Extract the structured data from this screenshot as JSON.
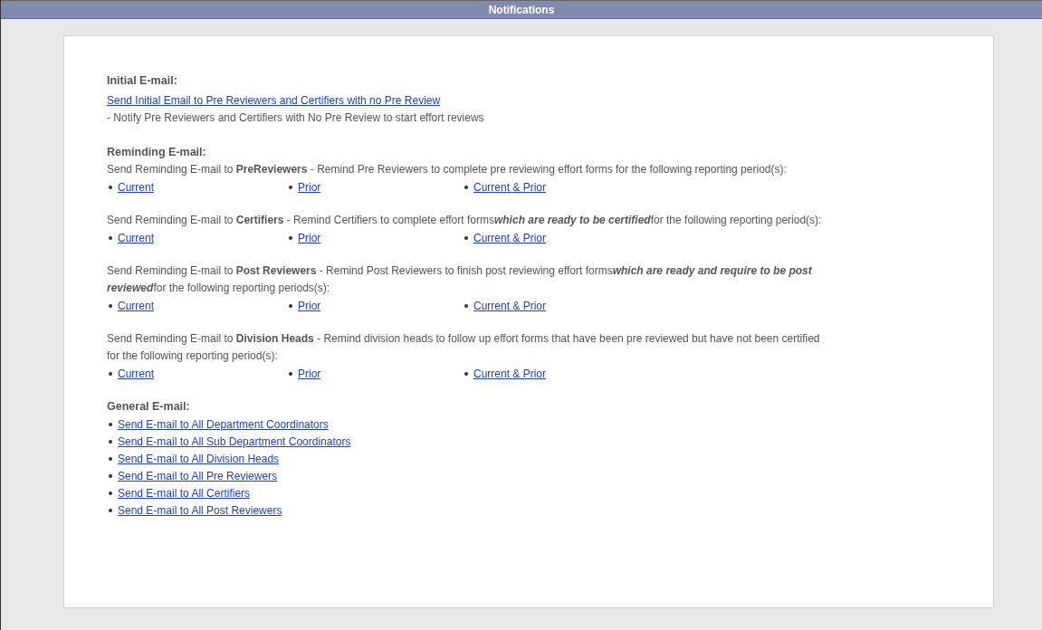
{
  "header": {
    "title": "Notifications"
  },
  "initial": {
    "heading": "Initial E-mail:",
    "link": "Send Initial Email to Pre Reviewers and Certifiers with no Pre Review",
    "note": "- Notify Pre Reviewers and Certifiers with No Pre Review to start effort reviews"
  },
  "reminding": {
    "heading": "Reminding E-mail:",
    "groups": [
      {
        "text": "Send Reminding E-mail to **PreReviewers** - Remind Pre Reviewers to complete pre reviewing effort forms for the following reporting period(s):",
        "links": [
          "Current",
          "Prior",
          "Current & Prior"
        ]
      },
      {
        "text": "Send Reminding E-mail to **Certifiers** - Remind Certifiers to complete effort forms",
        "emphasis": "which are ready to be certified",
        "tail": "for the following reporting period(s):",
        "links": [
          "Current",
          "Prior",
          "Current & Prior"
        ]
      },
      {
        "text": "Send Reminding E-mail to **Post Reviewers** - Remind Post Reviewers to finish post reviewing effort forms",
        "emphasis": "which are ready and require to be post reviewed",
        "tail": "for the following reporting periods(s):",
        "links": [
          "Current",
          "Prior",
          "Current & Prior"
        ]
      },
      {
        "text": "Send Reminding E-mail to **Division Heads** - Remind division heads to follow up effort forms that have been pre reviewed but have not been certified for the following reporting period(s):",
        "links": [
          "Current",
          "Prior",
          "Current & Prior"
        ]
      }
    ]
  },
  "general": {
    "heading": "General E-mail:",
    "links": [
      "Send E-mail to All Department Coordinators",
      "Send E-mail to All Sub Department Coordinators",
      "Send E-mail to All Division Heads",
      "Send E-mail to All Pre Reviewers",
      "Send E-mail to All Certifiers",
      "Send E-mail to All Post Reviewers"
    ]
  }
}
